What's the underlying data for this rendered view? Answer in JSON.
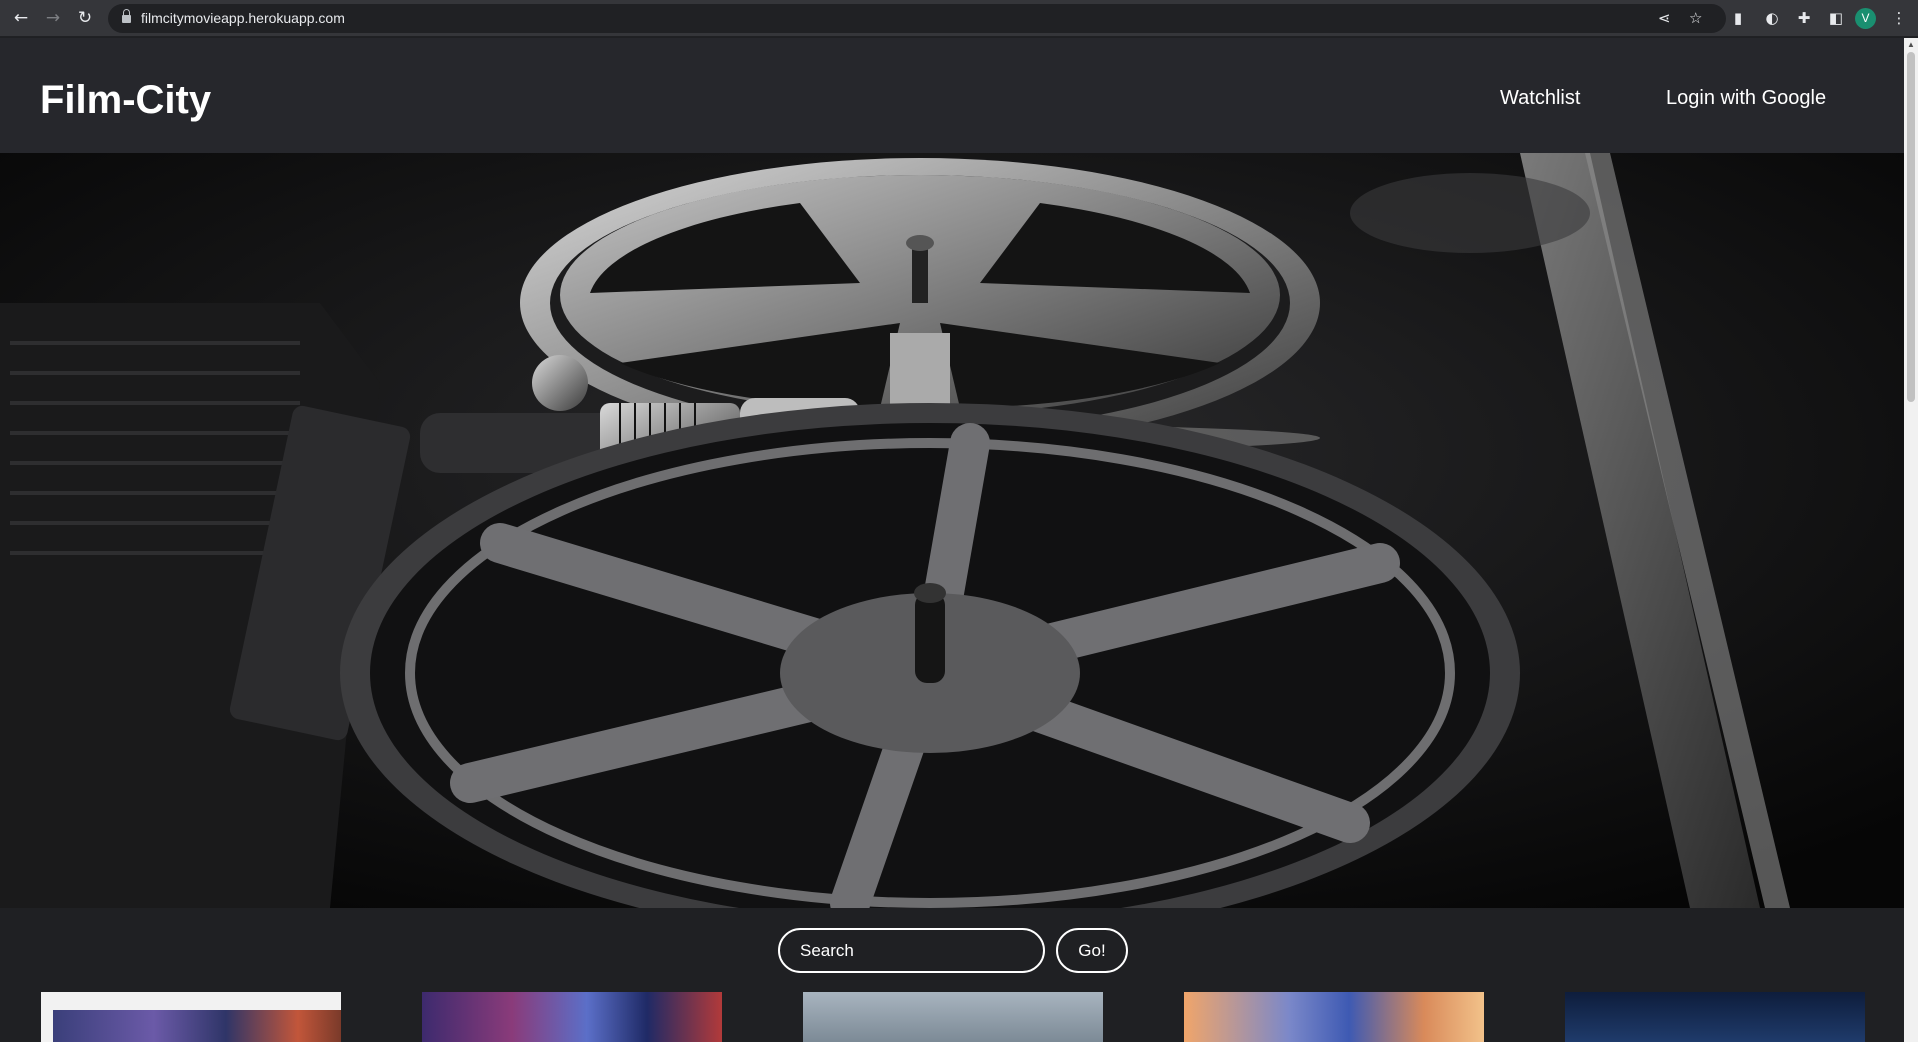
{
  "browser": {
    "url": "filmcitymovieapp.herokuapp.com",
    "profile_initial": "V",
    "icons": [
      "back-icon",
      "forward-icon",
      "reload-icon",
      "lock-icon",
      "share-icon",
      "star-icon",
      "extension-icon",
      "theme-icon",
      "puzzle-icon",
      "side-panel-icon",
      "menu-icon"
    ],
    "accent_profile": "#1a8f70"
  },
  "header": {
    "brand": "Film-City",
    "nav": {
      "watchlist": "Watchlist",
      "login": "Login with Google"
    }
  },
  "hero": {
    "image": "film-reel-projector"
  },
  "search": {
    "placeholder": "Search",
    "button": "Go!"
  },
  "movies": {
    "cards": [
      "movie-poster-1",
      "movie-poster-2",
      "movie-poster-3",
      "movie-poster-4",
      "movie-poster-5"
    ]
  },
  "colors": {
    "page_bg": "#1f2023",
    "header_bg": "#26272c",
    "text": "#ffffff"
  }
}
